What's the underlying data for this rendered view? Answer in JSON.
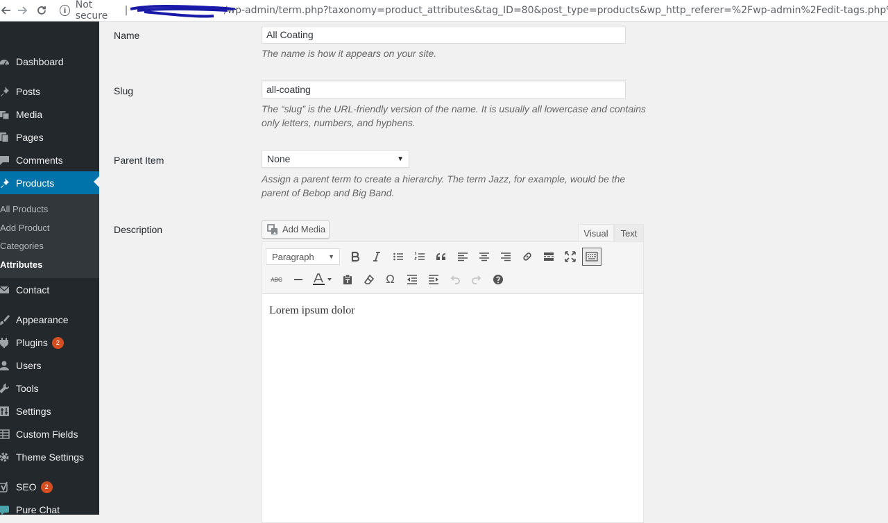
{
  "browser": {
    "security": "Not secure",
    "separator": "|",
    "url": "/wp-admin/term.php?taxonomy=product_attributes&tag_ID=80&post_type=products&wp_http_referer=%2Fwp-admin%2Fedit-tags.php%3Ftaxonomy%..."
  },
  "sidebar": {
    "items": [
      {
        "label": "Dashboard",
        "icon": "dashboard-icon"
      },
      {
        "label": "Posts",
        "icon": "pin-icon"
      },
      {
        "label": "Media",
        "icon": "media-icon"
      },
      {
        "label": "Pages",
        "icon": "pages-icon"
      },
      {
        "label": "Comments",
        "icon": "comment-icon"
      },
      {
        "label": "Products",
        "icon": "pin-icon",
        "active": true
      },
      {
        "label": "Contact",
        "icon": "mail-icon"
      },
      {
        "label": "Appearance",
        "icon": "brush-icon"
      },
      {
        "label": "Plugins",
        "icon": "plug-icon",
        "badge": "2"
      },
      {
        "label": "Users",
        "icon": "user-icon"
      },
      {
        "label": "Tools",
        "icon": "wrench-icon"
      },
      {
        "label": "Settings",
        "icon": "settings-icon"
      },
      {
        "label": "Custom Fields",
        "icon": "grid-icon"
      },
      {
        "label": "Theme Settings",
        "icon": "gear-icon"
      },
      {
        "label": "SEO",
        "icon": "seo-icon",
        "badge": "2"
      },
      {
        "label": "Pure Chat",
        "icon": "chat-icon"
      }
    ],
    "submenu": [
      {
        "label": "All Products"
      },
      {
        "label": "Add Product"
      },
      {
        "label": "Categories"
      },
      {
        "label": "Attributes",
        "current": true
      }
    ],
    "colors": {
      "background": "#23282d",
      "active": "#0073aa",
      "submenu": "#32373c",
      "badge": "#d54e21"
    }
  },
  "form": {
    "name": {
      "label": "Name",
      "value": "All Coating",
      "description": "The name is how it appears on your site."
    },
    "slug": {
      "label": "Slug",
      "value": "all-coating",
      "description": "The “slug” is the URL-friendly version of the name. It is usually all lowercase and contains only letters, numbers, and hyphens."
    },
    "parent": {
      "label": "Parent Item",
      "selected": "None",
      "description": "Assign a parent term to create a hierarchy. The term Jazz, for example, would be the parent of Bebop and Big Band."
    },
    "description": {
      "label": "Description",
      "add_media": "Add Media",
      "tab_visual": "Visual",
      "tab_text": "Text",
      "format": "Paragraph",
      "content": "Lorem ipsum dolor"
    }
  }
}
